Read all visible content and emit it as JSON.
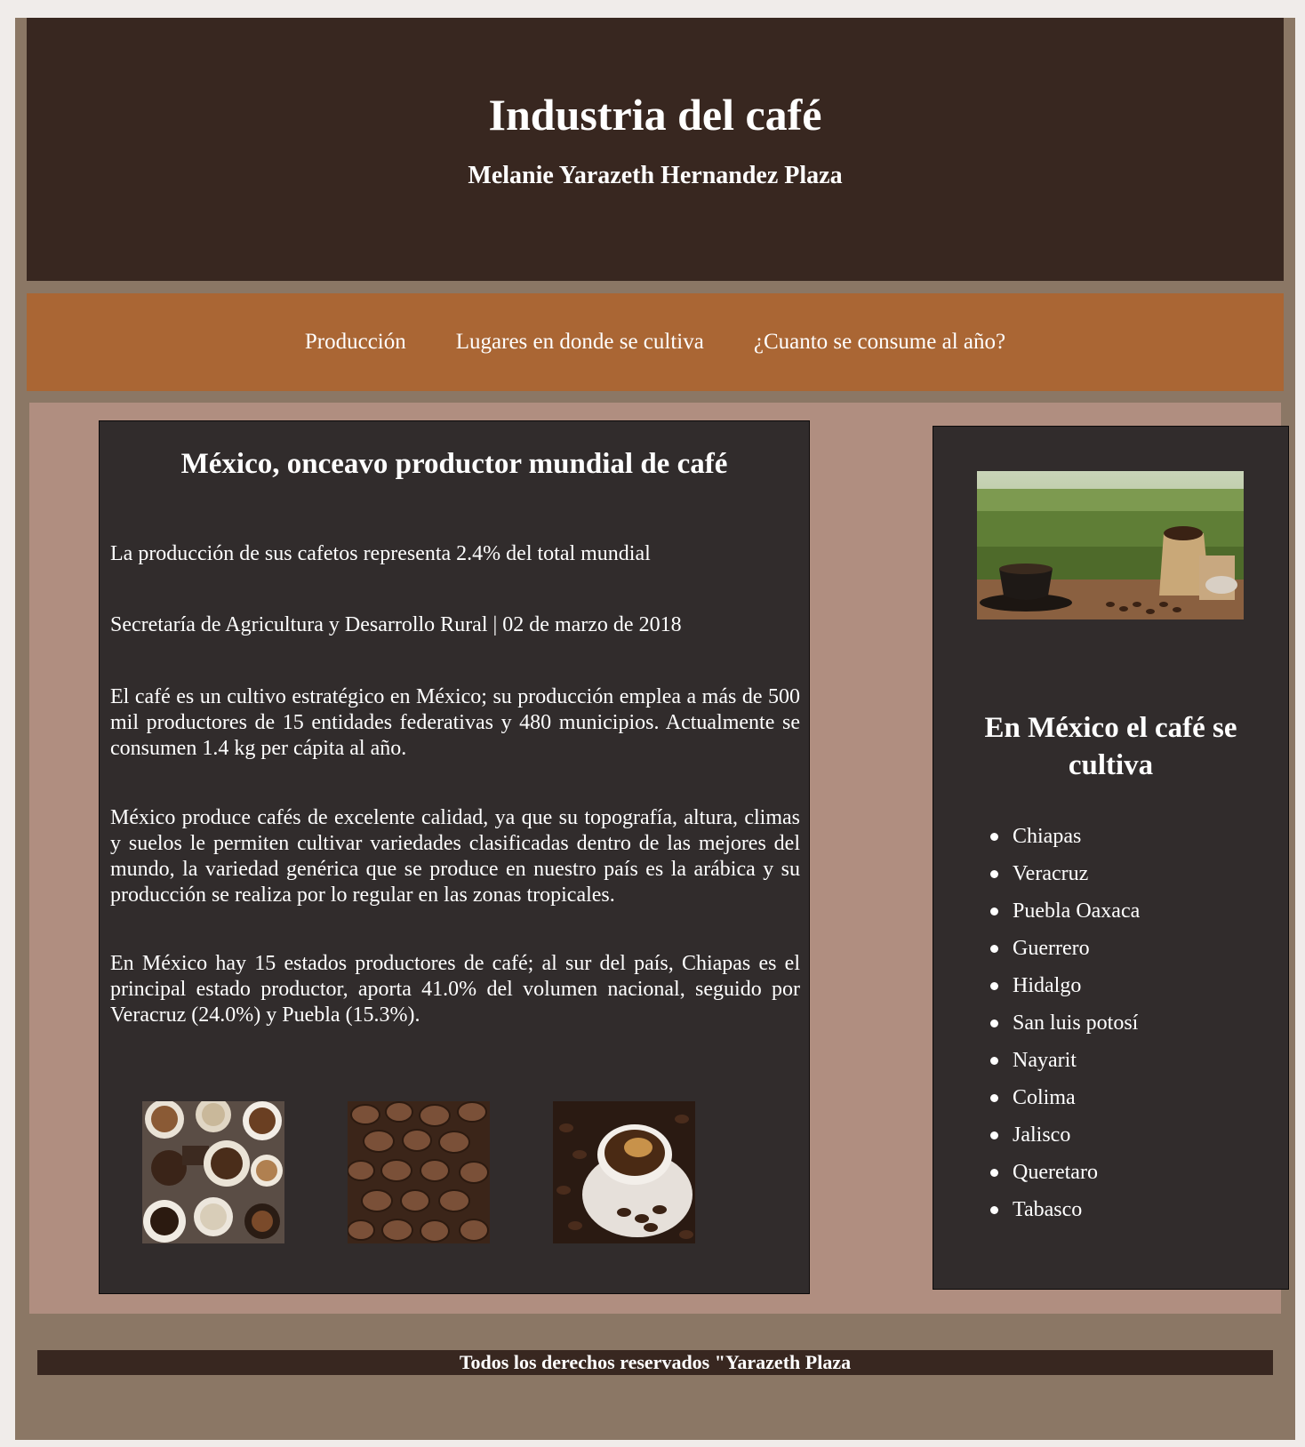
{
  "header": {
    "title": "Industria del café",
    "author": "Melanie Yarazeth Hernandez Plaza"
  },
  "nav": {
    "items": [
      {
        "label": "Producción"
      },
      {
        "label": "Lugares en donde se cultiva"
      },
      {
        "label": "¿Cuanto se consume al año?"
      }
    ]
  },
  "article": {
    "title": "México, onceavo productor mundial de café",
    "paragraphs": [
      "La producción de sus cafetos representa 2.4% del total mundial",
      "Secretaría de Agricultura y Desarrollo Rural | 02 de marzo de 2018",
      "El café es un cultivo estratégico en México; su producción emplea a más de 500 mil productores de 15 entidades federativas y 480 municipios. Actualmente se consumen 1.4 kg per cápita al año.",
      "México produce cafés de excelente calidad, ya que su topografía, altura, climas y suelos le permiten cultivar variedades clasificadas dentro de las mejores del mundo, la variedad genérica que se produce en nuestro país es la arábica y su producción se realiza por lo regular en las zonas tropicales.",
      "En México hay 15 estados productores de café; al sur del país, Chiapas es el principal estado productor, aporta 41.0% del volumen nacional, seguido por Veracruz (24.0%) y Puebla (15.3%)."
    ]
  },
  "aside": {
    "title": "En México el café se cultiva",
    "states": [
      "Chiapas",
      "Veracruz",
      "Puebla Oaxaca",
      "Guerrero",
      "Hidalgo",
      "San luis potosí",
      "Nayarit",
      "Colima",
      "Jalisco",
      "Queretaro",
      "Tabasco"
    ]
  },
  "footer": {
    "text": "Todos los derechos reservados \"Yarazeth Plaza"
  },
  "colors": {
    "page_bg": "#f0ecea",
    "frame_bg": "#8b7765",
    "header_bg": "#382720",
    "nav_bg": "#aa6634",
    "content_bg": "#b08e80",
    "panel_bg": "#312c2c"
  }
}
